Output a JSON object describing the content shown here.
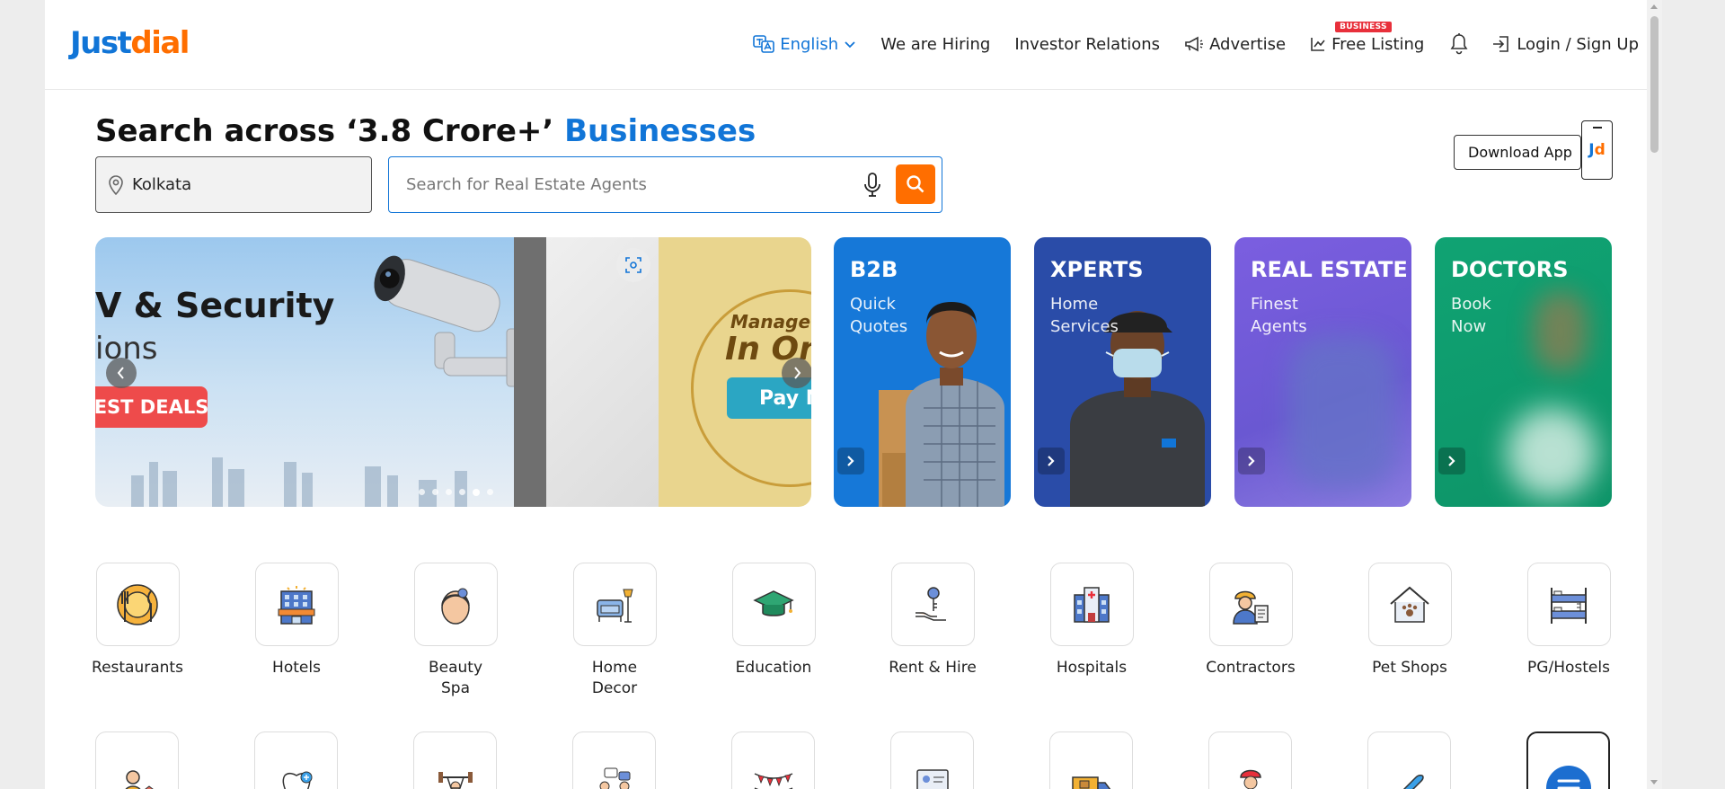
{
  "header": {
    "logo_part1": "Just",
    "logo_part2": "dial",
    "language": "English",
    "hiring": "We are Hiring",
    "investor": "Investor Relations",
    "advertise": "Advertise",
    "free_listing": "Free Listing",
    "business_badge": "BUSINESS",
    "login": "Login / Sign Up"
  },
  "search": {
    "headline_prefix": "Search across ‘3.8 Crore+’",
    "headline_highlight": "Businesses",
    "location": "Kolkata",
    "placeholder": "Search for Real Estate Agents",
    "download_app": "Download App",
    "jd_j": "J",
    "jd_d": "d"
  },
  "banner": {
    "title": "V & Security",
    "subtitle": "ions",
    "deal": "EST DEALS",
    "manage": "Manage &",
    "in_one": "In One",
    "pay": "Pay N"
  },
  "promo_cards": [
    {
      "title": "B2B",
      "sub1": "Quick",
      "sub2": "Quotes",
      "color": "#1175d7"
    },
    {
      "title": "XPERTS",
      "sub1": "Home",
      "sub2": "Services",
      "color": "#2248a8"
    },
    {
      "title": "REAL ESTATE",
      "sub1": "Finest",
      "sub2": "Agents",
      "color": "#7054d6"
    },
    {
      "title": "DOCTORS",
      "sub1": "Book",
      "sub2": "Now",
      "color": "#0c9a6e"
    }
  ],
  "categories": [
    {
      "label": "Restaurants",
      "icon": "restaurant-icon"
    },
    {
      "label": "Hotels",
      "icon": "hotel-icon"
    },
    {
      "label": "Beauty\nSpa",
      "icon": "beauty-spa-icon"
    },
    {
      "label": "Home\nDecor",
      "icon": "home-decor-icon"
    },
    {
      "label": "Education",
      "icon": "education-icon"
    },
    {
      "label": "Rent & Hire",
      "icon": "rent-hire-icon"
    },
    {
      "label": "Hospitals",
      "icon": "hospital-icon"
    },
    {
      "label": "Contractors",
      "icon": "contractor-icon"
    },
    {
      "label": "Pet Shops",
      "icon": "pet-shop-icon"
    },
    {
      "label": "PG/Hostels",
      "icon": "pg-hostel-icon"
    }
  ]
}
